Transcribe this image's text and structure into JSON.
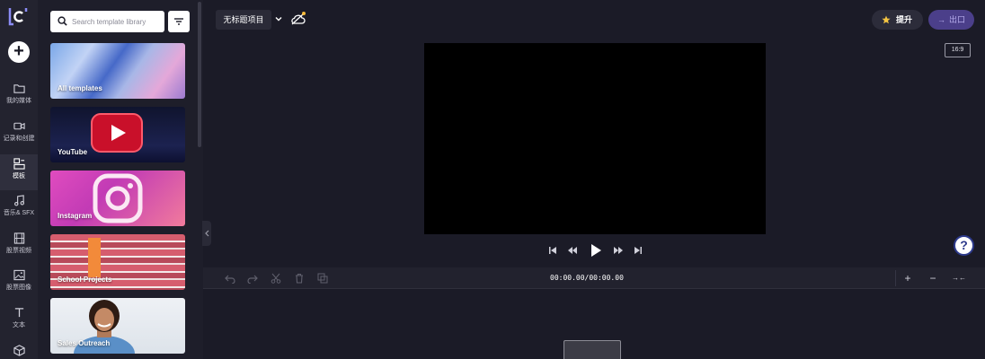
{
  "rail": {
    "items": [
      {
        "label": "我的媒体",
        "icon": "folder-icon"
      },
      {
        "label": "记录和创建",
        "icon": "video-camera-icon"
      },
      {
        "label": "模板",
        "icon": "templates-icon"
      },
      {
        "label": "音乐& SFX",
        "icon": "music-note-icon"
      },
      {
        "label": "股票视频",
        "icon": "film-icon"
      },
      {
        "label": "股票图像",
        "icon": "image-icon"
      },
      {
        "label": "文本",
        "icon": "text-icon"
      }
    ]
  },
  "panel": {
    "search_placeholder": "Search template library",
    "templates": [
      {
        "label": "All templates"
      },
      {
        "label": "YouTube"
      },
      {
        "label": "Instagram"
      },
      {
        "label": "School Projects"
      },
      {
        "label": "Sales Outreach"
      }
    ]
  },
  "header": {
    "project_name": "无标题项目",
    "upgrade_label": "提升",
    "export_label": "出口"
  },
  "preview": {
    "aspect_ratio": "16:9"
  },
  "timeline": {
    "timecode": "00:00.00/00:00.00",
    "zoom_in": "+",
    "zoom_out": "−",
    "fit": "→←"
  },
  "colors": {
    "background": "#1b1b27",
    "export_accent": "#4b3f8a",
    "help_ring": "#2d3a8c"
  }
}
